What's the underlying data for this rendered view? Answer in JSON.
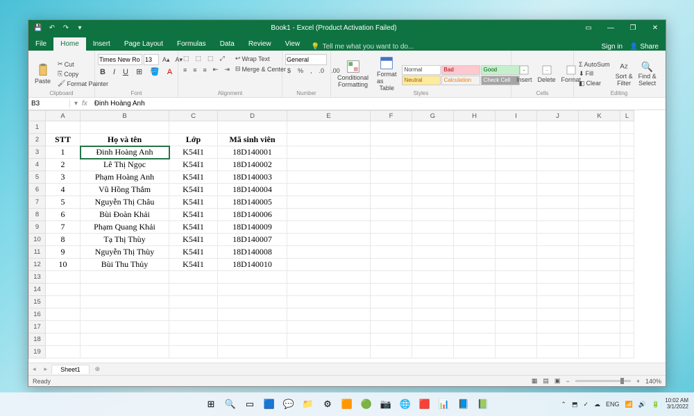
{
  "titlebar": {
    "title": "Book1 - Excel (Product Activation Failed)"
  },
  "ribbon_tabs": {
    "file": "File",
    "home": "Home",
    "insert": "Insert",
    "page_layout": "Page Layout",
    "formulas": "Formulas",
    "data": "Data",
    "review": "Review",
    "view": "View",
    "tell_me": "Tell me what you want to do...",
    "sign_in": "Sign in",
    "share": "Share"
  },
  "ribbon": {
    "paste": "Paste",
    "cut": "Cut",
    "copy": "Copy",
    "format_painter": "Format Painter",
    "clipboard": "Clipboard",
    "font_name": "Times New Ro",
    "font_size": "13",
    "font_group": "Font",
    "alignment_group": "Alignment",
    "wrap_text": "Wrap Text",
    "merge_center": "Merge & Center",
    "number_format": "General",
    "number_group": "Number",
    "conditional": "Conditional",
    "formatting": "Formatting",
    "format_as": "Format as",
    "table": "Table",
    "styles_group": "Styles",
    "style_normal": "Normal",
    "style_bad": "Bad",
    "style_good": "Good",
    "style_neutral": "Neutral",
    "style_calc": "Calculation",
    "style_check": "Check Cell",
    "insert_btn": "Insert",
    "delete_btn": "Delete",
    "format_btn": "Format",
    "cells_group": "Cells",
    "autosum": "AutoSum",
    "fill": "Fill",
    "clear": "Clear",
    "sort_filter": "Sort &",
    "filter2": "Filter",
    "find_select": "Find &",
    "select2": "Select",
    "editing_group": "Editing"
  },
  "namebox": {
    "ref": "B3",
    "fx": "fx",
    "formula": "Đinh Hoàng Anh"
  },
  "columns": [
    "A",
    "B",
    "C",
    "D",
    "E",
    "F",
    "G",
    "H",
    "I",
    "J",
    "K",
    "L"
  ],
  "headers": {
    "stt": "STT",
    "hoten": "Họ và tên",
    "lop": "Lớp",
    "msv": "Mã sinh viên"
  },
  "rows": [
    {
      "stt": "1",
      "name": "Đinh Hoàng Anh",
      "lop": "K54I1",
      "msv": "18D140001"
    },
    {
      "stt": "2",
      "name": "Lê Thị Ngọc",
      "lop": "K54I1",
      "msv": "18D140002"
    },
    {
      "stt": "3",
      "name": "Phạm Hoàng Anh",
      "lop": "K54I1",
      "msv": "18D140003"
    },
    {
      "stt": "4",
      "name": "Vũ Hồng Thắm",
      "lop": "K54I1",
      "msv": "18D140004"
    },
    {
      "stt": "5",
      "name": "Nguyễn Thị Châu",
      "lop": "K54I1",
      "msv": "18D140005"
    },
    {
      "stt": "6",
      "name": "Bùi Đoàn Khải",
      "lop": "K54I1",
      "msv": "18D140006"
    },
    {
      "stt": "7",
      "name": "Phạm Quang Khải",
      "lop": "K54I1",
      "msv": "18D140009"
    },
    {
      "stt": "8",
      "name": "Tạ Thị Thùy",
      "lop": "K54I1",
      "msv": "18D140007"
    },
    {
      "stt": "9",
      "name": "Nguyễn Thị Thùy",
      "lop": "K54I1",
      "msv": "18D140008"
    },
    {
      "stt": "10",
      "name": "Bùi Thu Thủy",
      "lop": "K54I1",
      "msv": "18D140010"
    }
  ],
  "sheet": {
    "name": "Sheet1",
    "add": "⊕"
  },
  "status": {
    "ready": "Ready",
    "zoom": "140%"
  },
  "taskbar": {
    "time": "10:02 AM",
    "date": "3/1/2022",
    "lang": "ENG"
  }
}
